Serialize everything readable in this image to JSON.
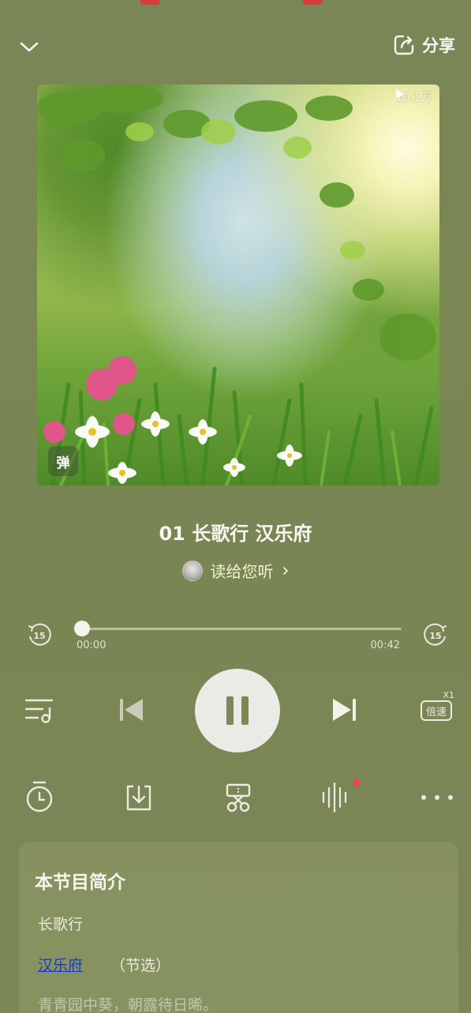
{
  "header": {
    "collapse_icon": "chevron-down-icon",
    "share_icon": "share-icon",
    "share_label": "分享"
  },
  "cover": {
    "play_count": "10.1万",
    "danmu_label": "弹"
  },
  "track": {
    "title": "01 长歌行 汉乐府",
    "author": "读给您听"
  },
  "progress": {
    "current_time": "00:00",
    "total_time": "00:42",
    "fraction": 0,
    "skip_back_label": "15",
    "skip_forward_label": "15"
  },
  "controls": {
    "speed_label": "倍速",
    "speed_multiplier": "X1"
  },
  "secondary": {
    "items": [
      "timer-icon",
      "download-icon",
      "clip-icon",
      "equalizer-icon",
      "more-icon"
    ]
  },
  "intro": {
    "heading": "本节目简介",
    "title_line": "长歌行",
    "author_link": "汉乐府",
    "note": "（节选）",
    "verse_line": "青青园中葵，朝露待日晞。"
  },
  "colors": {
    "background": "#7a8556",
    "link": "#1a38d0",
    "badge_dot": "#e74b3c"
  }
}
